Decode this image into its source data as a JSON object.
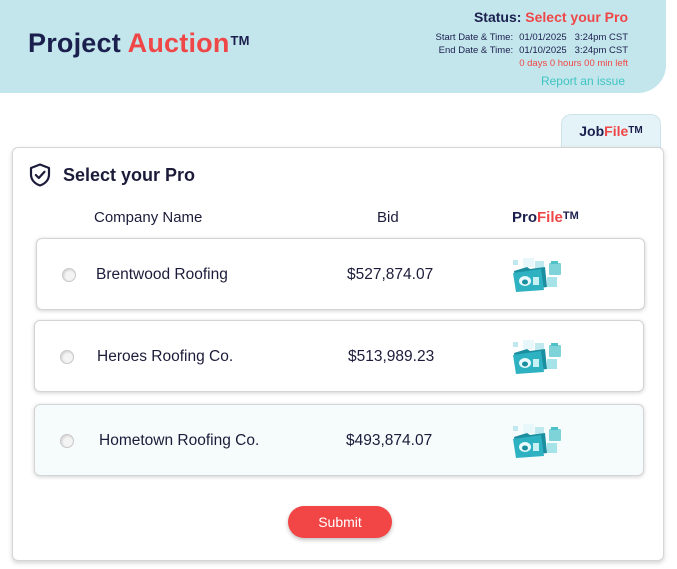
{
  "header": {
    "brand_part1": "Project ",
    "brand_part2": "Auction",
    "brand_tm": "TM",
    "status_label": "Status:",
    "status_value": "Select your Pro",
    "start_label": "Start Date & Time:",
    "start_date": "01/01/2025",
    "start_time": "3:24pm CST",
    "end_label": "End Date & Time:",
    "end_date": "01/10/2025",
    "end_time": "3:24pm CST",
    "time_remaining": "0 days 0 hours 00 min left",
    "report_link": "Report an issue"
  },
  "jobfile_tab": {
    "part1": "Job",
    "part2": "File",
    "tm": "TM"
  },
  "card": {
    "title": "Select your Pro",
    "col_company": "Company Name",
    "col_bid": "Bid",
    "col_profile_part1": "Pro",
    "col_profile_part2": "File",
    "col_profile_tm": "TM",
    "rows": [
      {
        "company": "Brentwood Roofing",
        "bid": "$527,874.07"
      },
      {
        "company": "Heroes Roofing Co.",
        "bid": "$513,989.23"
      },
      {
        "company": "Hometown Roofing Co.",
        "bid": "$493,874.07"
      }
    ],
    "submit_label": "Submit"
  },
  "colors": {
    "header_bg": "#c3e6ec",
    "brand_navy": "#1b1f4d",
    "accent_red": "#ef4747",
    "link_teal": "#3fc4c2",
    "submit_bg": "#f24545"
  },
  "icons": [
    "shield-check-icon",
    "profile-folder-icon"
  ]
}
